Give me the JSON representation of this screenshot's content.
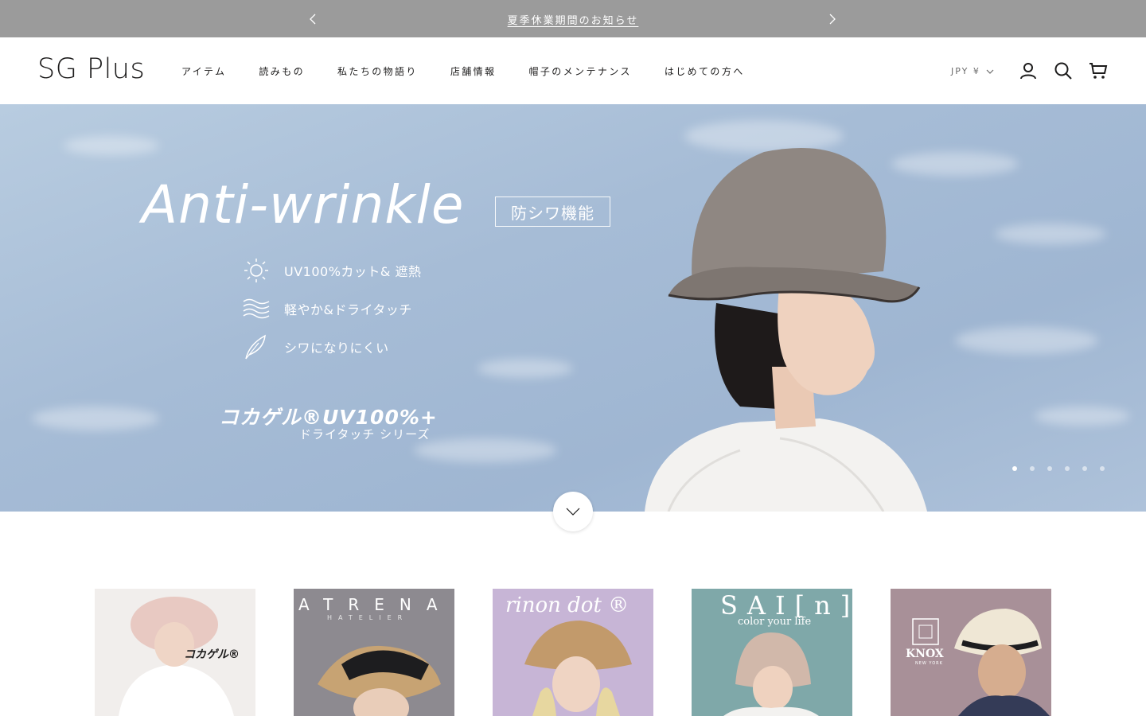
{
  "announcement": {
    "message": "夏季休業期間のお知らせ",
    "prev_icon": "chevron-left-icon",
    "next_icon": "chevron-right-icon"
  },
  "header": {
    "logo": "SG Plus",
    "nav": [
      {
        "label": "アイテム"
      },
      {
        "label": "読みもの"
      },
      {
        "label": "私たちの物語り"
      },
      {
        "label": "店舗情報"
      },
      {
        "label": "帽子のメンテナンス"
      },
      {
        "label": "はじめての方へ"
      }
    ],
    "currency": "JPY ¥",
    "icons": [
      "account-icon",
      "search-icon",
      "cart-icon"
    ]
  },
  "hero": {
    "title": "Anti-wrinkle",
    "badge": "防シワ機能",
    "features": [
      {
        "icon": "sun-icon",
        "label": "UV100%カット& 遮熱"
      },
      {
        "icon": "wave-icon",
        "label": "軽やか&ドライタッチ"
      },
      {
        "icon": "feather-icon",
        "label": "シワになりにくい"
      }
    ],
    "brand_mark": "コカゲル®UV100%+",
    "brand_sub": "ドライタッチ シリーズ",
    "slides_total": 6,
    "active_slide": 1
  },
  "tiles": [
    {
      "label": "コカゲル®",
      "bg": "#f1eeec"
    },
    {
      "label": "ATRENA",
      "sub": "HATELIER",
      "bg": "#8d8a90"
    },
    {
      "label": "rinon dot ®",
      "bg": "#c7b5d6"
    },
    {
      "label": "SAI[n]",
      "sub": "color your life",
      "bg": "#7fa8a9"
    },
    {
      "label": "KNOX",
      "sub": "NEW YORK",
      "bg": "#a89098"
    }
  ],
  "colors": {
    "announce_bg": "#9b9b9b",
    "hero_sky": "#a6bcd6",
    "text": "#1c1b1b"
  }
}
